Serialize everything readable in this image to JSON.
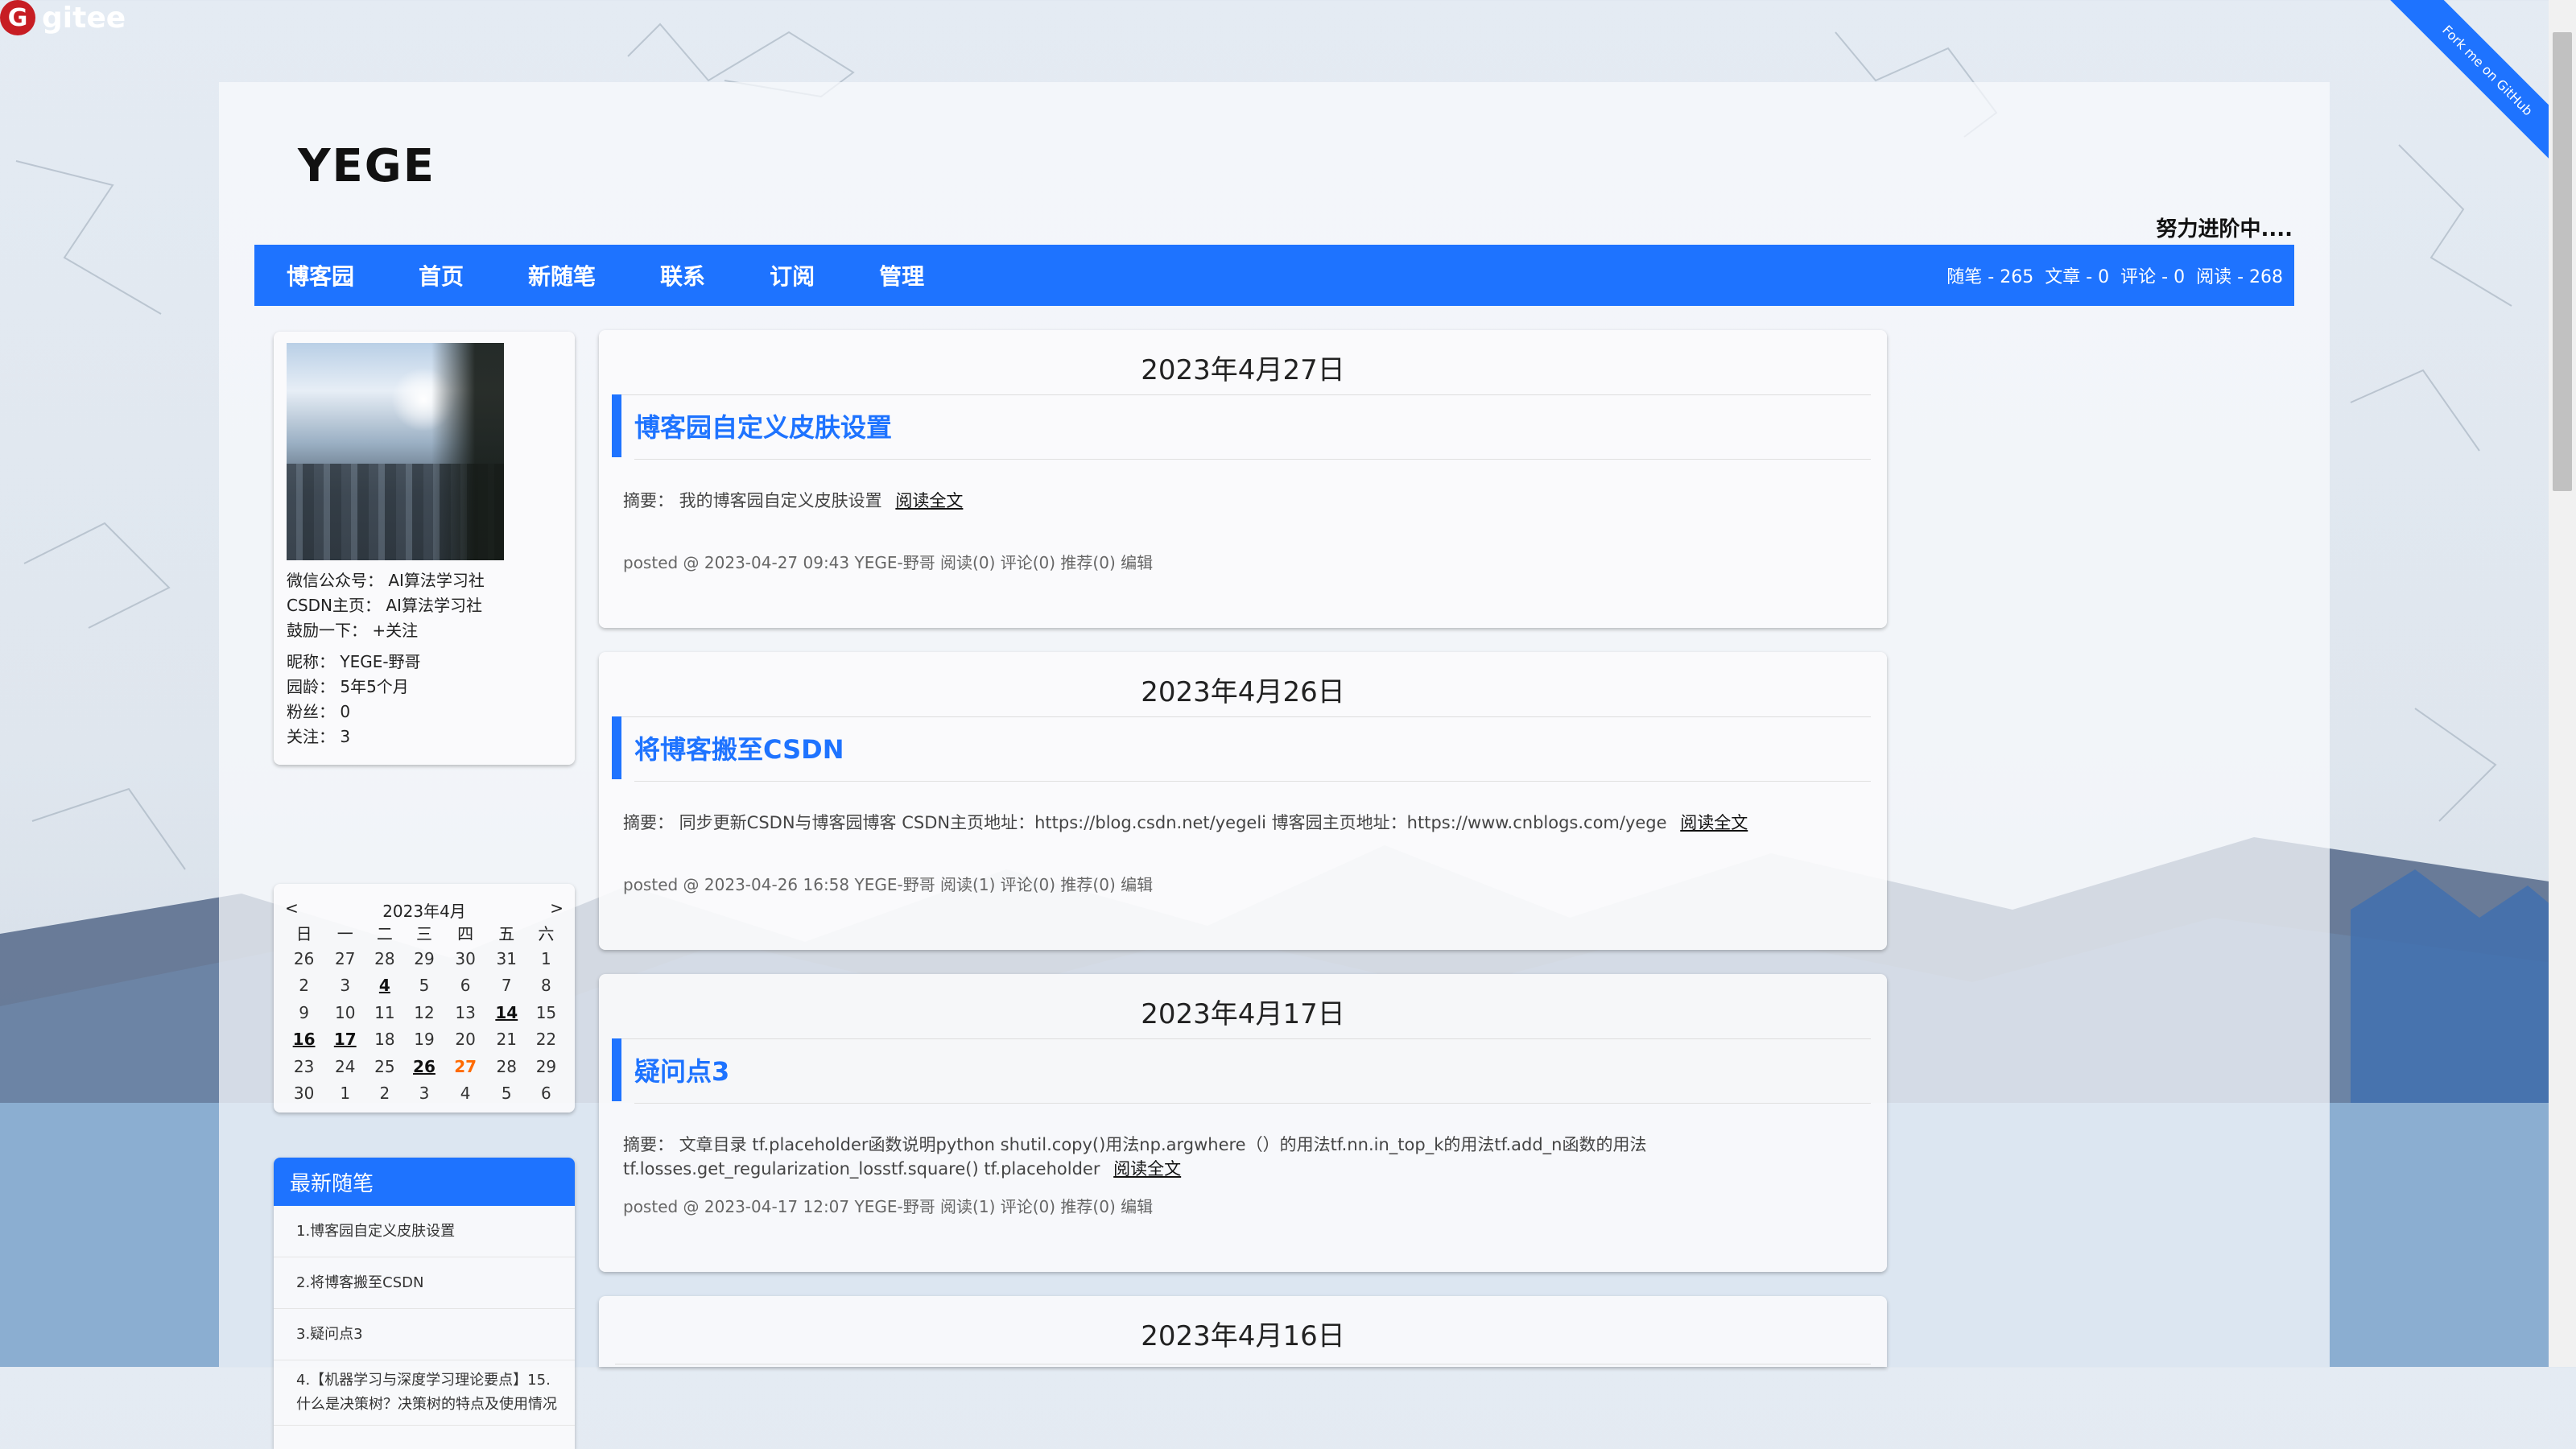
{
  "gitee": {
    "logo_letter": "G",
    "label": "gitee"
  },
  "ribbon": {
    "label": "Fork me on GitHub"
  },
  "site": {
    "title": "YEGE",
    "subtitle": "努力进阶中...."
  },
  "nav": {
    "items": [
      "博客园",
      "首页",
      "新随笔",
      "联系",
      "订阅",
      "管理"
    ],
    "stats": [
      "随笔 - 265",
      "文章 - 0",
      "评论 - 0",
      "阅读 - 268"
    ]
  },
  "profile": {
    "lines": [
      "微信公众号： AI算法学习社",
      "CSDN主页： AI算法学习社",
      "鼓励一下： +关注"
    ],
    "info": [
      "昵称： YEGE-野哥",
      "园龄： 5年5个月",
      "粉丝： 0",
      "关注： 3"
    ]
  },
  "calendar": {
    "prev": "<",
    "title": "2023年4月",
    "next": ">",
    "weekdays": [
      "日",
      "一",
      "二",
      "三",
      "四",
      "五",
      "六"
    ],
    "weeks": [
      [
        "26",
        "27",
        "28",
        "29",
        "30",
        "31",
        "1"
      ],
      [
        "2",
        "3",
        "4",
        "5",
        "6",
        "7",
        "8"
      ],
      [
        "9",
        "10",
        "11",
        "12",
        "13",
        "14",
        "15"
      ],
      [
        "16",
        "17",
        "18",
        "19",
        "20",
        "21",
        "22"
      ],
      [
        "23",
        "24",
        "25",
        "26",
        "27",
        "28",
        "29"
      ],
      [
        "30",
        "1",
        "2",
        "3",
        "4",
        "5",
        "6"
      ]
    ],
    "linked_days": [
      "4",
      "14",
      "16",
      "17",
      "26"
    ],
    "today": "27"
  },
  "recent": {
    "title": "最新随笔",
    "items": [
      "1.博客园自定义皮肤设置",
      "2.将博客搬至CSDN",
      "3.疑问点3",
      "4.【机器学习与深度学习理论要点】15. 什么是决策树？决策树的特点及使用情况"
    ]
  },
  "posts": [
    {
      "date": "2023年4月27日",
      "title": "博客园自定义皮肤设置",
      "summary": "摘要： 我的博客园自定义皮肤设置",
      "more": "阅读全文",
      "info": "posted @ 2023-04-27 09:43 YEGE-野哥 阅读(0) 评论(0) 推荐(0) 编辑"
    },
    {
      "date": "2023年4月26日",
      "title": "将博客搬至CSDN",
      "summary": "摘要： 同步更新CSDN与博客园博客 CSDN主页地址：https://blog.csdn.net/yegeli 博客园主页地址：https://www.cnblogs.com/yege",
      "more": "阅读全文",
      "info": "posted @ 2023-04-26 16:58 YEGE-野哥 阅读(1) 评论(0) 推荐(0) 编辑"
    },
    {
      "date": "2023年4月17日",
      "title": "疑问点3",
      "summary": "摘要： 文章目录 tf.placeholder函数说明python shutil.copy()用法np.argwhere（）的用法tf.nn.in_top_k的用法tf.add_n函数的用法tf.losses.get_regularization_losstf.square() tf.placeholder",
      "more": "阅读全文",
      "info": "posted @ 2023-04-17 12:07 YEGE-野哥 阅读(1) 评论(0) 推荐(0) 编辑"
    },
    {
      "date": "2023年4月16日"
    }
  ],
  "colors": {
    "accent": "#1e73ff",
    "today": "#ff6a00",
    "gitee": "#c71d23"
  }
}
